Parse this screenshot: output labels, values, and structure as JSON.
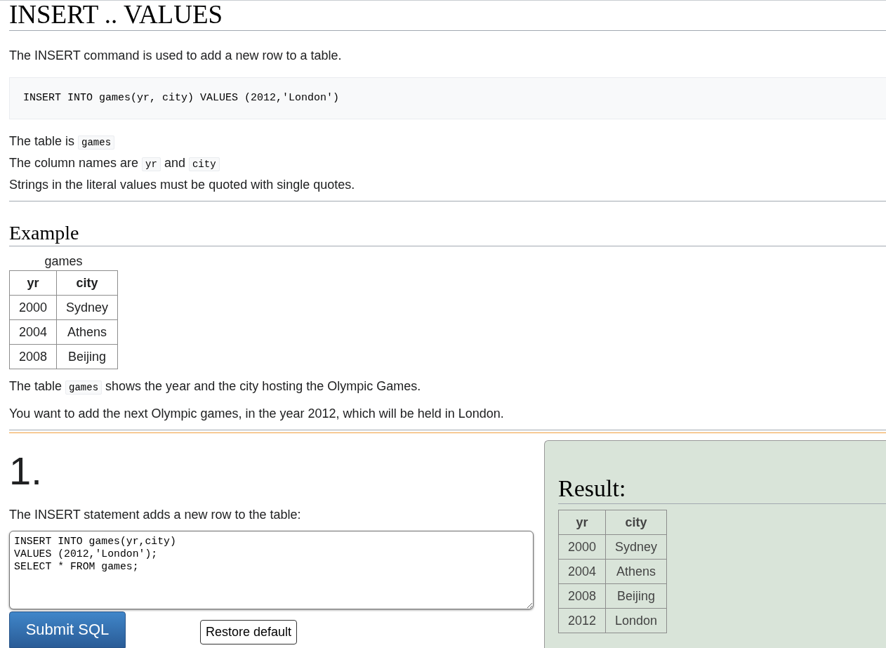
{
  "page_title": "INSERT .. VALUES",
  "intro": "The INSERT command is used to add a new row to a table.",
  "code_example": "INSERT INTO games(yr, city) VALUES (2012,'London')",
  "notes": [
    {
      "segments": [
        {
          "kind": "text",
          "text": "The table is "
        },
        {
          "kind": "code",
          "text": "games"
        }
      ]
    },
    {
      "segments": [
        {
          "kind": "text",
          "text": "The column names are "
        },
        {
          "kind": "code",
          "text": "yr"
        },
        {
          "kind": "text",
          "text": " and "
        },
        {
          "kind": "code",
          "text": "city"
        }
      ]
    },
    {
      "segments": [
        {
          "kind": "text",
          "text": "Strings in the literal values must be quoted with single quotes."
        }
      ]
    }
  ],
  "example": {
    "heading": "Example",
    "table": {
      "caption": "games",
      "columns": [
        "yr",
        "city"
      ],
      "rows": [
        [
          "2000",
          "Sydney"
        ],
        [
          "2004",
          "Athens"
        ],
        [
          "2008",
          "Beijing"
        ]
      ]
    },
    "paragraphs": [
      {
        "segments": [
          {
            "kind": "text",
            "text": "The table "
          },
          {
            "kind": "code",
            "text": "games"
          },
          {
            "kind": "text",
            "text": " shows the year and the city hosting the Olympic Games."
          }
        ]
      },
      {
        "segments": [
          {
            "kind": "text",
            "text": "You want to add the next Olympic games, in the year 2012, which will be held in London."
          }
        ]
      }
    ]
  },
  "exercise": {
    "number": "1.",
    "prompt": "The INSERT statement adds a new row to the table:",
    "sql": "INSERT INTO games(yr,city)\nVALUES (2012,'London');\nSELECT * FROM games;",
    "buttons": [
      {
        "kind": "primary",
        "label": "Submit SQL"
      },
      {
        "kind": "secondary",
        "label": "Restore default"
      }
    ]
  },
  "result": {
    "heading": "Result:",
    "table": {
      "columns": [
        "yr",
        "city"
      ],
      "rows": [
        [
          "2000",
          "Sydney"
        ],
        [
          "2004",
          "Athens"
        ],
        [
          "2008",
          "Beijing"
        ],
        [
          "2012",
          "London"
        ]
      ]
    }
  }
}
